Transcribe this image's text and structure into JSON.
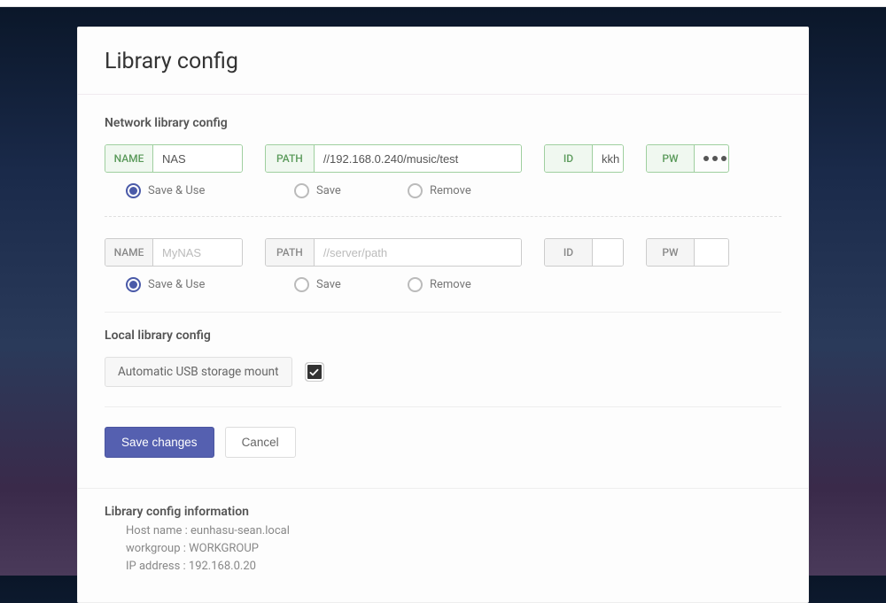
{
  "page": {
    "title": "Library config"
  },
  "network": {
    "section_title": "Network library config",
    "labels": {
      "name": "NAME",
      "path": "PATH",
      "id": "ID",
      "pw": "PW"
    },
    "entries": [
      {
        "style": "green",
        "name_value": "NAS",
        "path_value": "//192.168.0.240/music/test",
        "id_value": "kkh",
        "pw_masked": true,
        "actions_selected": 0
      },
      {
        "style": "plain",
        "name_value": "",
        "name_placeholder": "MyNAS",
        "path_value": "",
        "path_placeholder": "//server/path",
        "id_value": "",
        "pw_value": "",
        "actions_selected": 0
      }
    ],
    "actions": {
      "save_use": "Save & Use",
      "save": "Save",
      "remove": "Remove"
    }
  },
  "local": {
    "section_title": "Local library config",
    "usb_label": "Automatic USB storage mount",
    "usb_checked": true
  },
  "buttons": {
    "save": "Save changes",
    "cancel": "Cancel"
  },
  "info": {
    "title": "Library config information",
    "lines": [
      "Host name : eunhasu-sean.local",
      "workgroup : WORKGROUP",
      "IP address : 192.168.0.20"
    ]
  }
}
